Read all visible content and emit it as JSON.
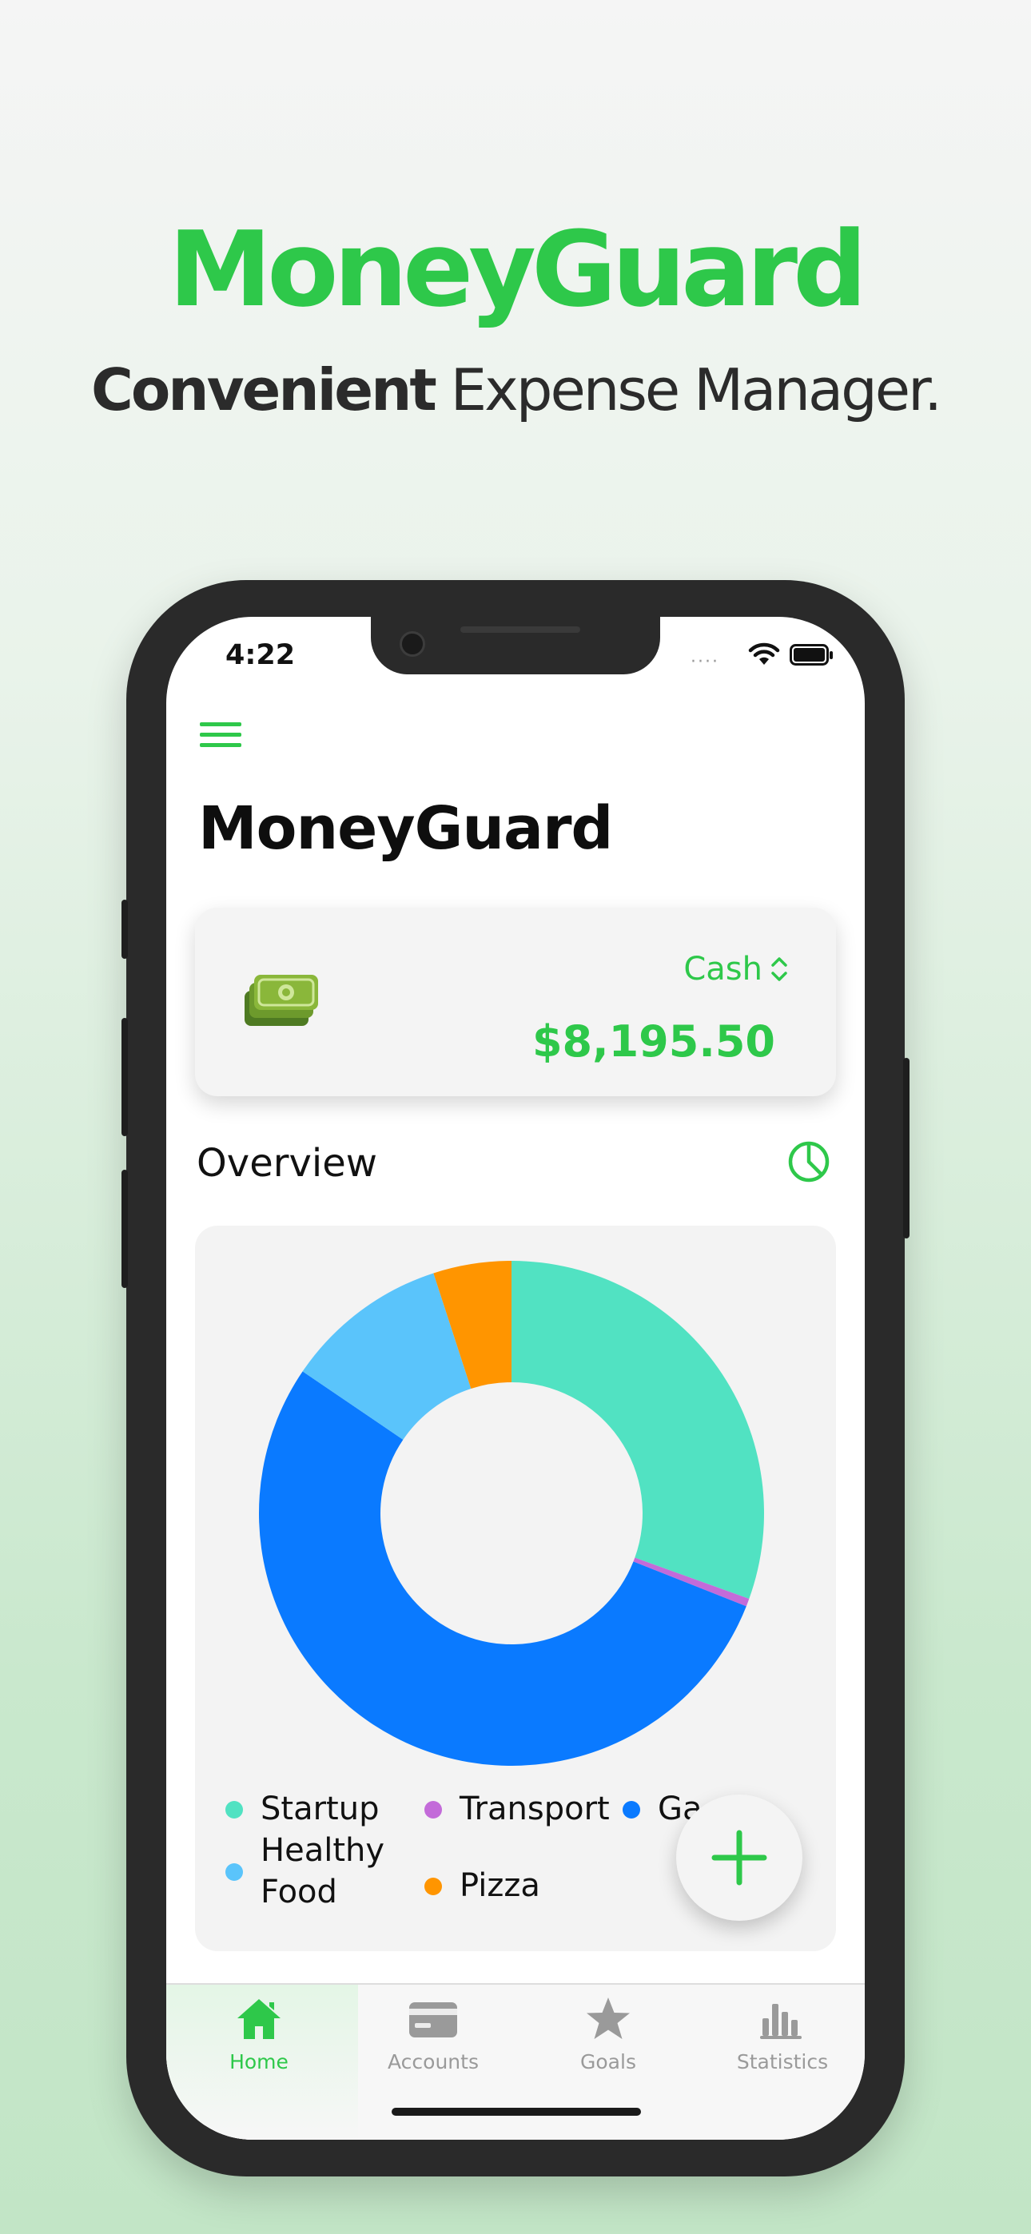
{
  "promo": {
    "title": "MoneyGuard",
    "subtitle_bold": "Convenient",
    "subtitle_rest": "Expense Manager."
  },
  "status_bar": {
    "time": "4:22",
    "signal": "····"
  },
  "header": {
    "menu_icon": "hamburger-menu-icon",
    "title": "MoneyGuard"
  },
  "balance_card": {
    "icon": "cash-money-icon",
    "account": "Cash",
    "selector_icon": "chevron-up-down-icon",
    "balance": "$8,195.50"
  },
  "overview": {
    "label": "Overview",
    "toggle_icon": "pie-chart-icon"
  },
  "chart_data": {
    "type": "pie",
    "style": "donut",
    "slices": [
      {
        "label": "Startup",
        "value": 30.5,
        "color": "#51e2c2"
      },
      {
        "label": "Transport",
        "value": 0.5,
        "color": "#c36bd9"
      },
      {
        "label": "Ga",
        "value": 53.5,
        "color": "#0a7aff"
      },
      {
        "label": "Healthy Food",
        "value": 10.5,
        "color": "#5ac4fb"
      },
      {
        "label": "Pizza",
        "value": 5.0,
        "color": "#ff9500"
      }
    ],
    "legend": [
      {
        "label": "Startup",
        "color": "#51e2c2"
      },
      {
        "label": "Transport",
        "color": "#c36bd9"
      },
      {
        "label": "Ga",
        "color": "#0a7aff"
      },
      {
        "label": "Healthy Food",
        "color": "#5ac4fb"
      },
      {
        "label": "Pizza",
        "color": "#ff9500"
      }
    ]
  },
  "fab": {
    "icon": "plus-icon"
  },
  "tab_bar": {
    "tabs": [
      {
        "label": "Home",
        "icon": "home-icon",
        "active": true
      },
      {
        "label": "Accounts",
        "icon": "credit-card-icon",
        "active": false
      },
      {
        "label": "Goals",
        "icon": "star-icon",
        "active": false
      },
      {
        "label": "Statistics",
        "icon": "bar-chart-icon",
        "active": false
      }
    ]
  },
  "colors": {
    "accent": "#2ec84a",
    "inactive": "#9a9a9a"
  }
}
